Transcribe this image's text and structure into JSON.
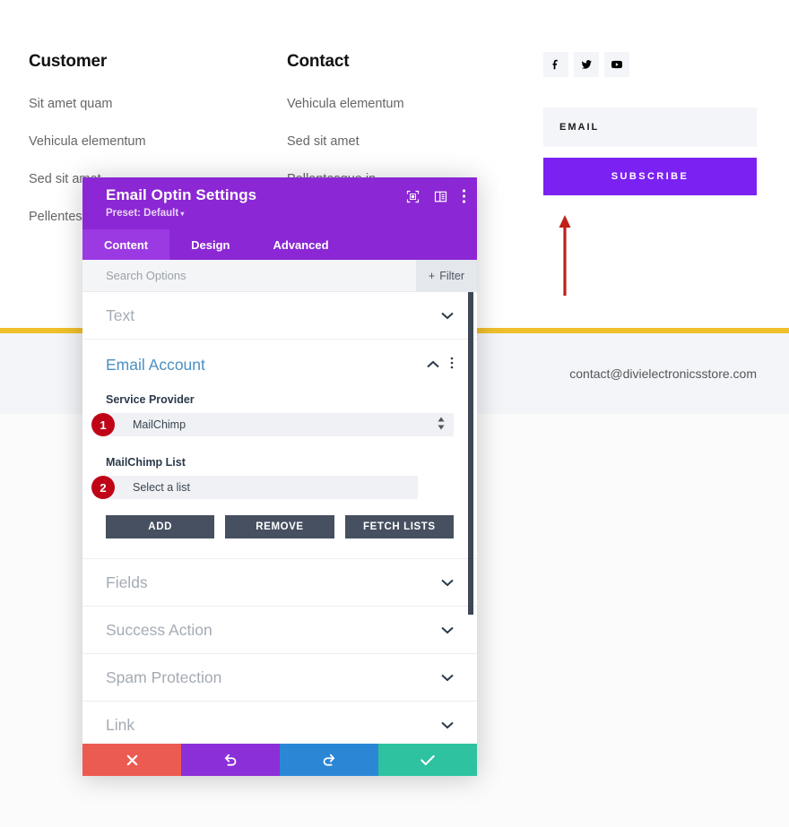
{
  "page": {
    "columns": [
      {
        "heading": "Customer",
        "links": [
          "Sit amet quam",
          "Vehicula elementum",
          "Sed sit amet",
          "Pellentesque in"
        ]
      },
      {
        "heading": "Contact",
        "links": [
          "Vehicula elementum",
          "Sed sit amet",
          "Pellentesque in"
        ]
      }
    ],
    "social": [
      {
        "name": "facebook-icon",
        "label": "f"
      },
      {
        "name": "twitter-icon",
        "label": "t"
      },
      {
        "name": "youtube-icon",
        "label": "y"
      }
    ],
    "optin": {
      "email_placeholder": "EMAIL",
      "subscribe_label": "SUBSCRIBE",
      "button_color": "#7b21f2"
    },
    "divider_color": "#f0bf2c",
    "contact_email": "contact@divielectronicsstore.com"
  },
  "modal": {
    "title": "Email Optin Settings",
    "preset": "Preset: Default",
    "header_icons": [
      "focus-icon",
      "layout-icon",
      "more-options-icon"
    ],
    "tabs": [
      {
        "label": "Content",
        "active": true
      },
      {
        "label": "Design",
        "active": false
      },
      {
        "label": "Advanced",
        "active": false
      }
    ],
    "search_placeholder": "Search Options",
    "filter_label": "Filter",
    "accent_color": "#8b27d4",
    "sections": [
      {
        "title": "Text",
        "open": false
      },
      {
        "title": "Fields",
        "open": false
      },
      {
        "title": "Success Action",
        "open": false
      },
      {
        "title": "Spam Protection",
        "open": false
      },
      {
        "title": "Link",
        "open": false
      }
    ],
    "email_account": {
      "title": "Email Account",
      "service_provider_label": "Service Provider",
      "service_provider_value": "MailChimp",
      "service_provider_badge": "1",
      "list_label": "MailChimp List",
      "list_value": "Select a list",
      "list_badge": "2",
      "buttons": [
        {
          "label": "ADD"
        },
        {
          "label": "REMOVE"
        },
        {
          "label": "FETCH LISTS"
        }
      ]
    },
    "footer_buttons": [
      {
        "name": "cancel-button",
        "icon": "close-icon",
        "color": "#ec5b51"
      },
      {
        "name": "undo-button",
        "icon": "undo-icon",
        "color": "#8b2fd8"
      },
      {
        "name": "redo-button",
        "icon": "redo-icon",
        "color": "#2b87d6"
      },
      {
        "name": "save-button",
        "icon": "check-icon",
        "color": "#2ec2a0"
      }
    ]
  },
  "annotation": {
    "arrow_color": "#c0201a"
  }
}
